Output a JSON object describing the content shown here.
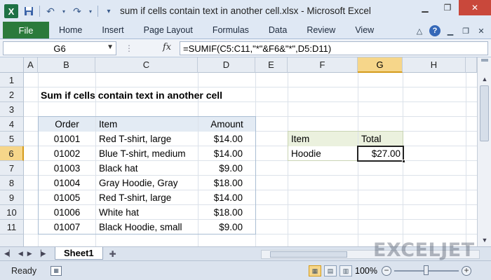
{
  "window": {
    "title": "sum if cells contain text in another cell.xlsx - Microsoft Excel",
    "app_icon": "X"
  },
  "ribbon": {
    "file": "File",
    "tabs": [
      "Home",
      "Insert",
      "Page Layout",
      "Formulas",
      "Data",
      "Review",
      "View"
    ]
  },
  "formula_bar": {
    "name_box": "G6",
    "fx": "fx",
    "formula": "=SUMIF(C5:C11,\"*\"&F6&\"*\",D5:D11)"
  },
  "columns": [
    "A",
    "B",
    "C",
    "D",
    "E",
    "F",
    "G",
    "H"
  ],
  "selected_column": "G",
  "rows": [
    "1",
    "2",
    "3",
    "4",
    "5",
    "6",
    "7",
    "8",
    "9",
    "10",
    "11"
  ],
  "selected_row": "6",
  "sheet": {
    "heading": "Sum if cells contain text in another cell",
    "table": {
      "headers": [
        "Order",
        "Item",
        "Amount"
      ],
      "rows": [
        [
          "01001",
          "Red T-shirt, large",
          "$14.00"
        ],
        [
          "01002",
          "Blue T-shirt, medium",
          "$14.00"
        ],
        [
          "01003",
          "Black hat",
          "$9.00"
        ],
        [
          "01004",
          "Gray Hoodie, Gray",
          "$18.00"
        ],
        [
          "01005",
          "Red T-shirt, large",
          "$14.00"
        ],
        [
          "01006",
          "White hat",
          "$18.00"
        ],
        [
          "01007",
          "Black Hoodie, small",
          "$9.00"
        ]
      ]
    },
    "summary": {
      "headers": [
        "Item",
        "Total"
      ],
      "item": "Hoodie",
      "total": "$27.00"
    }
  },
  "sheet_tabs": {
    "active": "Sheet1"
  },
  "status_bar": {
    "status": "Ready",
    "zoom": "100%"
  },
  "watermark": "EXCELJET"
}
